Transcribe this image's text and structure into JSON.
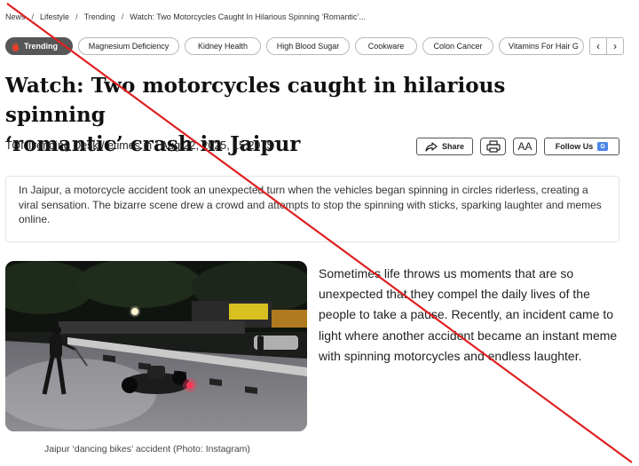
{
  "breadcrumb": {
    "items": [
      "News",
      "Lifestyle",
      "Trending",
      "Watch: Two Motorcycles Caught In Hilarious Spinning ‘Romantic’..."
    ],
    "separator": "/"
  },
  "tags": {
    "trending_label": "Trending",
    "items": [
      "Magnesium Deficiency",
      "Kidney Health",
      "High Blood Sugar",
      "Cookware",
      "Colon Cancer",
      "Vitamins For Hair G"
    ],
    "prev_icon": "‹",
    "next_icon": "›"
  },
  "article": {
    "headline_line1": "Watch: Two motorcycles caught in hilarious spinning",
    "headline_line2": "‘romantic’ crash in Jaipur",
    "byline": "TOI Trending Desk / etimes.in / Aug 22, 2025, 15:29 IST",
    "summary": "In Jaipur, a motorcycle accident took an unexpected turn when the vehicles began spinning in circles riderless, creating a viral sensation. The bizarre scene drew a crowd and attempts to stop the spinning with sticks, sparking laughter and memes online.",
    "caption": "Jaipur ‘dancing bikes’ accident (Photo: Instagram)",
    "body": "Sometimes life throws us moments that are so unexpected that they compel the daily lives of the people to take a pause. Recently, an incident came to light where another accident became an instant meme with spinning motorcycles and endless laughter."
  },
  "actions": {
    "share_label": "Share",
    "font_size_label": "AA",
    "follow_label": "Follow Us",
    "follow_badge": "G"
  },
  "icons": {
    "trending": "flame-icon",
    "share": "share-icon",
    "print": "print-icon",
    "font_size": "font-size-icon",
    "follow": "google-news-icon"
  },
  "colors": {
    "trending_bg": "#575757",
    "strike_line": "#e02020"
  }
}
